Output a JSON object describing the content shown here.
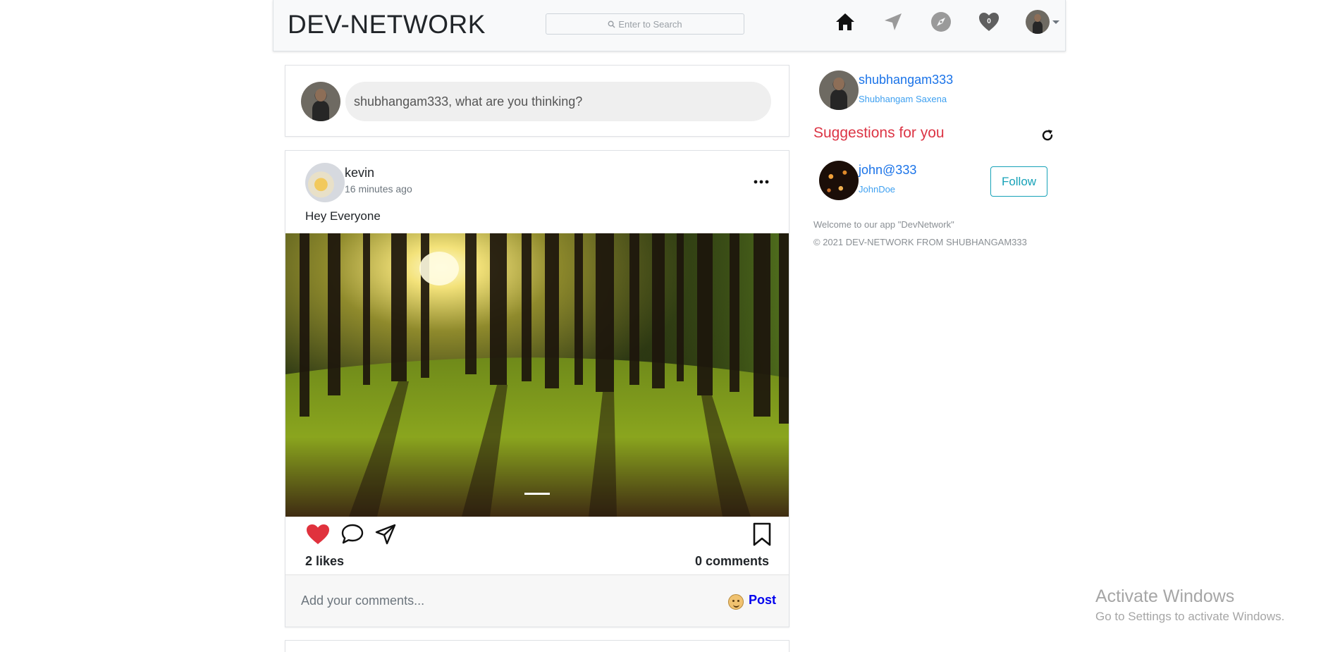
{
  "navbar": {
    "brand": "DEV-NETWORK",
    "search_placeholder": "Enter to Search",
    "heart_count": "0",
    "icons": [
      "home-icon",
      "send-icon",
      "compass-icon",
      "heart-icon",
      "avatar"
    ]
  },
  "composer": {
    "placeholder": "shubhangam333, what are you thinking?"
  },
  "post": {
    "username": "kevin",
    "time": "16 minutes ago",
    "text": "Hey Everyone",
    "likes": "2 likes",
    "comments": "0 comments",
    "comment_placeholder": "Add your comments...",
    "post_label": "Post",
    "liked": true
  },
  "sidebar": {
    "username": "shubhangam333",
    "fullname": "Shubhangam Saxena",
    "suggestions_title": "Suggestions for you",
    "suggestions": [
      {
        "username": "john@333",
        "fullname": "JohnDoe",
        "button": "Follow"
      }
    ],
    "footer_line1": "Welcome to our app \"DevNetwork\"",
    "footer_line2": "© 2021 DEV-NETWORK FROM SHUBHANGAM333"
  },
  "watermark": {
    "line1": "Activate Windows",
    "line2": "Go to Settings to activate Windows."
  },
  "colors": {
    "brand_link": "#1a73e8",
    "suggestions_title": "#dc3545",
    "follow": "#17a2b8",
    "like": "#e0323d",
    "post_button": "#0000ee"
  }
}
